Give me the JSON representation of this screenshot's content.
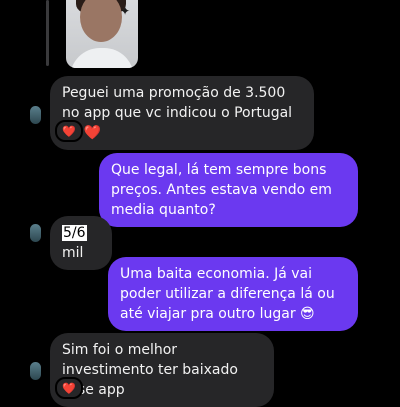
{
  "messages": [
    {
      "side": "in",
      "text": "Peguei uma promoção de 3.500 no app que vc indicou o Portugal 🙏 ❤️",
      "reaction": "❤️"
    },
    {
      "side": "out",
      "text": "Que legal, lá tem sempre bons preços. Antes estava vendo em media quanto?"
    },
    {
      "side": "in",
      "prefix_highlight": "5/6",
      "rest": " mil"
    },
    {
      "side": "out",
      "text": "Uma baita economia. Já vai poder utilizar a diferença lá ou até viajar pra outro lugar 😎"
    },
    {
      "side": "in",
      "text": "Sim foi o melhor investimento ter baixado esse app",
      "reaction": "❤️"
    }
  ],
  "icons": {
    "reaction": "heart-icon",
    "sparkle": "sparkle-icon"
  },
  "colors": {
    "outgoing_bubble": "#6b39f0",
    "incoming_bubble": "#262628",
    "reaction_heart": "#ff3040"
  }
}
